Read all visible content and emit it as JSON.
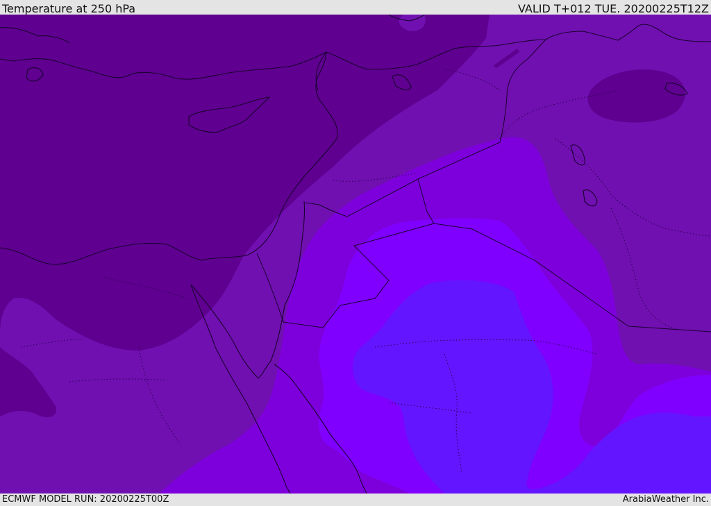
{
  "header": {
    "title": "Temperature at 250 hPa",
    "valid": "VALID T+012 TUE. 20200225T12Z"
  },
  "footer": {
    "run": "ECMWF MODEL RUN: 20200225T00Z",
    "credit": "ArabiaWeather Inc."
  },
  "map": {
    "variable": "temperature",
    "level": "250 hPa",
    "colors": {
      "coldest_band": "#5f0090",
      "cold_band": "#7010b0",
      "mid_band": "#7d00dc",
      "warm_band": "#7f00ff",
      "warmest_band": "#6415ff",
      "boundaries": "#1a0030"
    }
  }
}
